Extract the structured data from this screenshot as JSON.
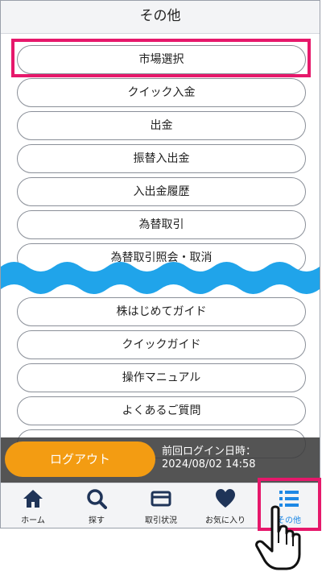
{
  "header": {
    "title": "その他"
  },
  "menu": {
    "items": [
      {
        "label": "市場選択"
      },
      {
        "label": "クイック入金"
      },
      {
        "label": "出金"
      },
      {
        "label": "振替入出金"
      },
      {
        "label": "入出金履歴"
      },
      {
        "label": "為替取引"
      },
      {
        "label": "為替取引照会・取消"
      },
      {
        "label": "株はじめてガイド"
      },
      {
        "label": "クイックガイド"
      },
      {
        "label": "操作マニュアル"
      },
      {
        "label": "よくあるご質問"
      }
    ]
  },
  "footer": {
    "logout_label": "ログアウト",
    "last_login_label": "前回ログイン日時：",
    "last_login_value": "2024/08/02 14:58"
  },
  "tabs": [
    {
      "label": "ホーム",
      "icon": "home-icon"
    },
    {
      "label": "探す",
      "icon": "search-icon"
    },
    {
      "label": "取引状況",
      "icon": "card-icon"
    },
    {
      "label": "お気に入り",
      "icon": "heart-icon"
    },
    {
      "label": "その他",
      "icon": "list-icon",
      "active": true
    }
  ],
  "colors": {
    "accent": "#e6186b",
    "active_tab": "#1e88e5",
    "logout": "#f39c12",
    "wave": "#20a4ea"
  }
}
